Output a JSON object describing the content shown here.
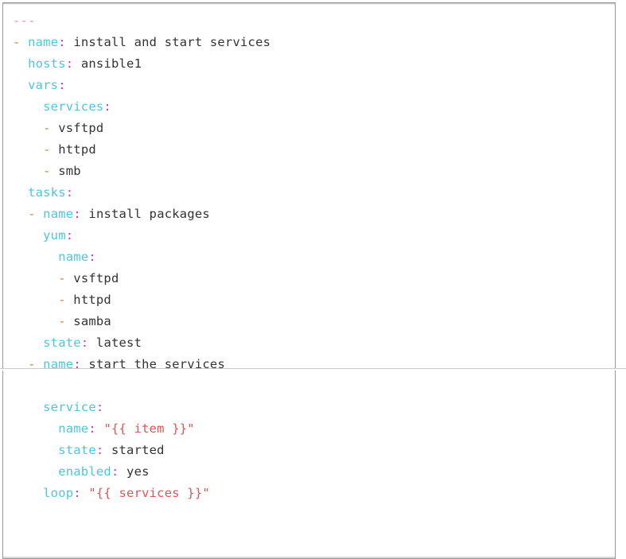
{
  "document": {
    "language": "yaml",
    "kind": "ansible-playbook",
    "colors": {
      "background": "#ffffff",
      "border": "#9a9a9a",
      "document_marker": "#d98fd9",
      "dash": "#d2843c",
      "key": "#4fc5dd",
      "colon": "#c23fc2",
      "value": "#333333",
      "string": "#dd5555"
    },
    "lines": [
      {
        "indent": "",
        "tokens": [
          {
            "type": "doc",
            "text": "---"
          }
        ]
      },
      {
        "indent": "",
        "tokens": [
          {
            "type": "dash",
            "text": "-"
          },
          {
            "type": "space",
            "text": " "
          },
          {
            "type": "key",
            "text": "name"
          },
          {
            "type": "colon",
            "text": ":"
          },
          {
            "type": "space",
            "text": " "
          },
          {
            "type": "val",
            "text": "install and start services"
          }
        ]
      },
      {
        "indent": "  ",
        "tokens": [
          {
            "type": "key",
            "text": "hosts"
          },
          {
            "type": "colon",
            "text": ":"
          },
          {
            "type": "space",
            "text": " "
          },
          {
            "type": "val",
            "text": "ansible1"
          }
        ]
      },
      {
        "indent": "  ",
        "tokens": [
          {
            "type": "key",
            "text": "vars"
          },
          {
            "type": "colon",
            "text": ":"
          }
        ]
      },
      {
        "indent": "    ",
        "tokens": [
          {
            "type": "key",
            "text": "services"
          },
          {
            "type": "colon",
            "text": ":"
          }
        ]
      },
      {
        "indent": "    ",
        "tokens": [
          {
            "type": "dash",
            "text": "-"
          },
          {
            "type": "space",
            "text": " "
          },
          {
            "type": "val",
            "text": "vsftpd"
          }
        ]
      },
      {
        "indent": "    ",
        "tokens": [
          {
            "type": "dash",
            "text": "-"
          },
          {
            "type": "space",
            "text": " "
          },
          {
            "type": "val",
            "text": "httpd"
          }
        ]
      },
      {
        "indent": "    ",
        "tokens": [
          {
            "type": "dash",
            "text": "-"
          },
          {
            "type": "space",
            "text": " "
          },
          {
            "type": "val",
            "text": "smb"
          }
        ]
      },
      {
        "indent": "  ",
        "tokens": [
          {
            "type": "key",
            "text": "tasks"
          },
          {
            "type": "colon",
            "text": ":"
          }
        ]
      },
      {
        "indent": "  ",
        "tokens": [
          {
            "type": "dash",
            "text": "-"
          },
          {
            "type": "space",
            "text": " "
          },
          {
            "type": "key",
            "text": "name"
          },
          {
            "type": "colon",
            "text": ":"
          },
          {
            "type": "space",
            "text": " "
          },
          {
            "type": "val",
            "text": "install packages"
          }
        ]
      },
      {
        "indent": "    ",
        "tokens": [
          {
            "type": "key",
            "text": "yum"
          },
          {
            "type": "colon",
            "text": ":"
          }
        ]
      },
      {
        "indent": "      ",
        "tokens": [
          {
            "type": "key",
            "text": "name"
          },
          {
            "type": "colon",
            "text": ":"
          }
        ]
      },
      {
        "indent": "      ",
        "tokens": [
          {
            "type": "dash",
            "text": "-"
          },
          {
            "type": "space",
            "text": " "
          },
          {
            "type": "val",
            "text": "vsftpd"
          }
        ]
      },
      {
        "indent": "      ",
        "tokens": [
          {
            "type": "dash",
            "text": "-"
          },
          {
            "type": "space",
            "text": " "
          },
          {
            "type": "val",
            "text": "httpd"
          }
        ]
      },
      {
        "indent": "      ",
        "tokens": [
          {
            "type": "dash",
            "text": "-"
          },
          {
            "type": "space",
            "text": " "
          },
          {
            "type": "val",
            "text": "samba"
          }
        ]
      },
      {
        "indent": "    ",
        "tokens": [
          {
            "type": "key",
            "text": "state"
          },
          {
            "type": "colon",
            "text": ":"
          },
          {
            "type": "space",
            "text": " "
          },
          {
            "type": "val",
            "text": "latest"
          }
        ]
      },
      {
        "indent": "  ",
        "tokens": [
          {
            "type": "dash",
            "text": "-"
          },
          {
            "type": "space",
            "text": " "
          },
          {
            "type": "key",
            "text": "name"
          },
          {
            "type": "colon",
            "text": ":"
          },
          {
            "type": "space",
            "text": " "
          },
          {
            "type": "val",
            "text": "start the services"
          }
        ]
      },
      {
        "indent": "",
        "tokens": []
      },
      {
        "indent": "    ",
        "tokens": [
          {
            "type": "key",
            "text": "service"
          },
          {
            "type": "colon",
            "text": ":"
          }
        ]
      },
      {
        "indent": "      ",
        "tokens": [
          {
            "type": "key",
            "text": "name"
          },
          {
            "type": "colon",
            "text": ":"
          },
          {
            "type": "space",
            "text": " "
          },
          {
            "type": "str",
            "text": "\"{{ item }}\""
          }
        ]
      },
      {
        "indent": "      ",
        "tokens": [
          {
            "type": "key",
            "text": "state"
          },
          {
            "type": "colon",
            "text": ":"
          },
          {
            "type": "space",
            "text": " "
          },
          {
            "type": "val",
            "text": "started"
          }
        ]
      },
      {
        "indent": "      ",
        "tokens": [
          {
            "type": "key",
            "text": "enabled"
          },
          {
            "type": "colon",
            "text": ":"
          },
          {
            "type": "space",
            "text": " "
          },
          {
            "type": "val",
            "text": "yes"
          }
        ]
      },
      {
        "indent": "    ",
        "tokens": [
          {
            "type": "key",
            "text": "loop"
          },
          {
            "type": "colon",
            "text": ":"
          },
          {
            "type": "space",
            "text": " "
          },
          {
            "type": "str",
            "text": "\"{{ services }}\""
          }
        ]
      }
    ],
    "plain_text": "---\n- name: install and start services\n  hosts: ansible1\n  vars:\n    services:\n    - vsftpd\n    - httpd\n    - smb\n  tasks:\n  - name: install packages\n    yum:\n      name:\n      - vsftpd\n      - httpd\n      - samba\n    state: latest\n  - name: start the services\n\n    service:\n      name: \"{{ item }}\"\n      state: started\n      enabled: yes\n    loop: \"{{ services }}\"\n"
  }
}
